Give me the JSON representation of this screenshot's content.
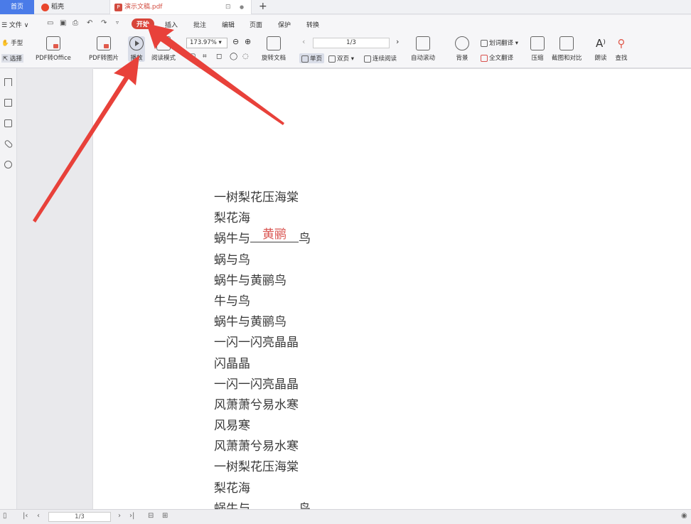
{
  "tabs": {
    "home": "首页",
    "app": "稻壳",
    "doc": "演示文稿.pdf",
    "doc_pin": "⊡",
    "doc_dot": "●",
    "add": "+"
  },
  "menu": {
    "file": "☰ 文件 ∨",
    "start": "开始",
    "insert": "插入",
    "annotate": "批注",
    "edit": "编辑",
    "page": "页面",
    "protect": "保护",
    "convert": "转换"
  },
  "ribbon": {
    "hand": "手型",
    "select": "选择",
    "pdf_to_office": "PDF转Office",
    "pdf_to_image": "PDF转图片",
    "play": "播放",
    "read_mode": "阅读模式",
    "zoom_value": "173.97%",
    "rotate": "旋转文档",
    "page_value": "1/3",
    "single": "单页",
    "double": "双页",
    "continuous": "连续阅读",
    "auto_scroll": "自动滚动",
    "background": "背景",
    "word_translate": "划词翻译",
    "full_translate": "全文翻译",
    "compress": "压缩",
    "screenshot_compare": "截图和对比",
    "read_aloud": "朗读",
    "find": "查找"
  },
  "document": {
    "lines_before": [
      "一树梨花压海棠",
      "梨花海"
    ],
    "blank_line": {
      "prefix": "蜗牛与",
      "fill": "黄鹂",
      "suffix": "鸟"
    },
    "lines_after": [
      "蜗与鸟",
      "蜗牛与黄鹂鸟",
      "牛与鸟",
      "蜗牛与黄鹂鸟",
      "一闪一闪亮晶晶",
      "闪晶晶",
      "一闪一闪亮晶晶",
      "风萧萧兮易水寒",
      "风易寒",
      "风萧萧兮易水寒",
      "一树梨花压海棠",
      "梨花海"
    ],
    "cut_line": {
      "prefix": "蜗牛与",
      "suffix": "鸟"
    }
  },
  "status": {
    "page_value": "1/3"
  },
  "colors": {
    "accent_blue": "#4a7be8",
    "start_red": "#d8453a",
    "fill_red": "#d9534f",
    "arrow_red": "#e8413a"
  }
}
